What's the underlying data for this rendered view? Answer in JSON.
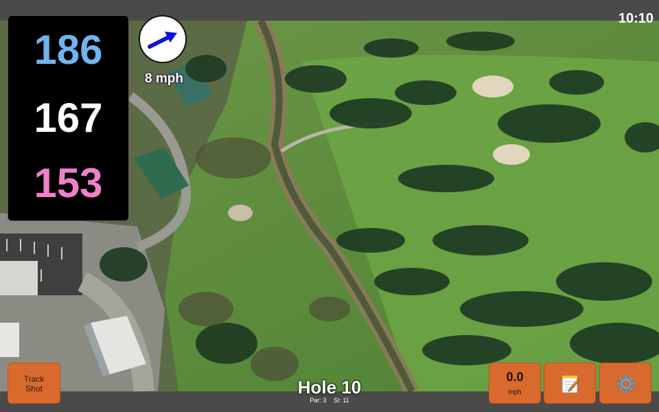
{
  "status": {
    "time": "10:10"
  },
  "distances": {
    "back": "186",
    "middle": "167",
    "front": "153"
  },
  "wind": {
    "speed_label": "8 mph",
    "direction_icon": "wind-arrow-icon"
  },
  "hole": {
    "title": "Hole 10",
    "par_label": "Par: 3",
    "si_label": "SI: 11"
  },
  "buttons": {
    "track_shot_label": "Track\nShot",
    "speed_value": "0.0",
    "speed_unit": "mph",
    "notes_icon": "notepad-icon",
    "settings_icon": "gear-icon"
  },
  "colors": {
    "back_distance": "#6fb3f0",
    "middle_distance": "#ffffff",
    "front_distance": "#f080c8",
    "button": "#d96a2e",
    "wind_arrow": "#1010e0"
  }
}
